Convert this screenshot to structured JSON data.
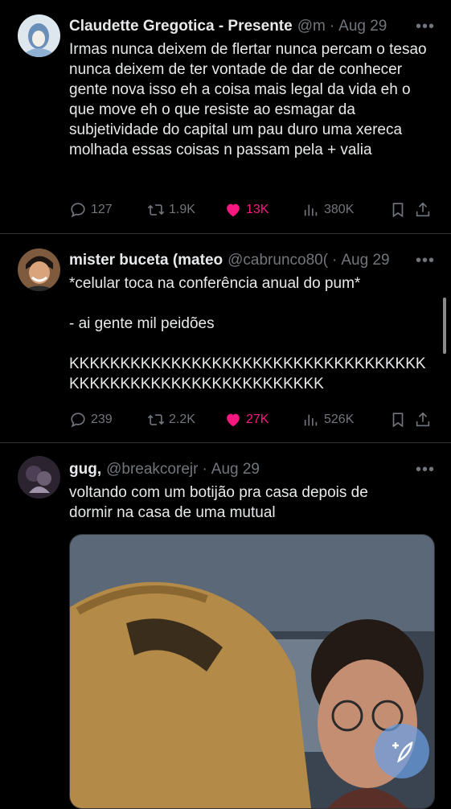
{
  "tweets": [
    {
      "name": "Claudette Gregotica - Presente",
      "handle": "@m",
      "date": "Aug 29",
      "text": "Irmas nunca deixem de flertar nunca percam o tesao nunca deixem de ter vontade de dar de conhecer gente nova isso eh a coisa mais legal da vida eh o que move eh o que resiste ao esmagar da subjetividade do capital um pau duro uma xereca molhada essas coisas n passam pela + valia",
      "replies": "127",
      "retweets": "1.9K",
      "likes": "13K",
      "views": "380K",
      "liked": true
    },
    {
      "name": "mister buceta (mateo",
      "handle": "@cabrunco80(",
      "date": "Aug 29",
      "text": "*celular toca na conferência anual do pum*\n\n- ai gente mil peidões\n\nKKKKKKKKKKKKKKKKKKKKKKKKKKKKKKKKKKKKKKKKKKKKKKKKKKKKKKKKKKKK",
      "replies": "239",
      "retweets": "2.2K",
      "likes": "27K",
      "views": "526K",
      "liked": true
    },
    {
      "name": "gug,",
      "handle": "@breakcorejr",
      "date": "Aug 29",
      "text": "voltando com um botijão pra casa depois de dormir na casa de uma mutual"
    }
  ],
  "more_icon": "more-dots-icon",
  "colors": {
    "like_active": "#f91880",
    "muted": "#71767b",
    "text": "#e7e9ea",
    "divider": "#2f3336",
    "fab": "#69a0e6"
  }
}
